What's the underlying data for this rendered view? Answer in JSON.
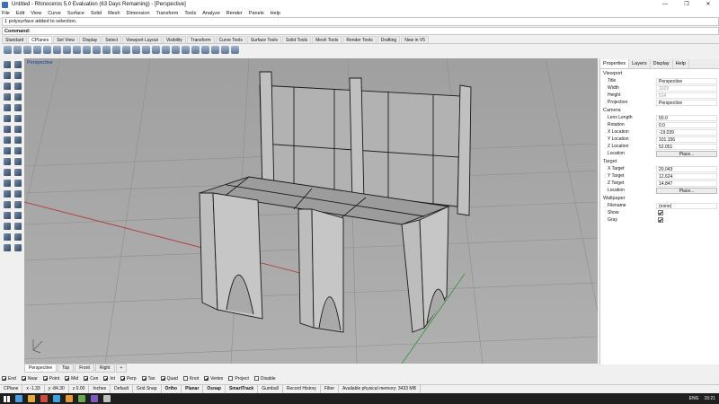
{
  "window": {
    "title": "Untitled - Rhinoceros 5.0 Evaluation (63 Days Remaining) - [Perspective]",
    "minimize": "—",
    "maximize": "❐",
    "close": "✕"
  },
  "menu": [
    "File",
    "Edit",
    "View",
    "Curve",
    "Surface",
    "Solid",
    "Mesh",
    "Dimension",
    "Transform",
    "Tools",
    "Analyze",
    "Render",
    "Panels",
    "Help"
  ],
  "history": "1 polysurface added to selection.",
  "command": {
    "label": "Command:",
    "value": ""
  },
  "tabs": [
    "Standard",
    "CPlanes",
    "Set View",
    "Display",
    "Select",
    "Viewport Layout",
    "Visibility",
    "Transform",
    "Curve Tools",
    "Surface Tools",
    "Solid Tools",
    "Mesh Tools",
    "Render Tools",
    "Drafting",
    "New in V5"
  ],
  "active_tab": "CPlanes",
  "viewport": {
    "label": "Perspective",
    "axis": "x y z"
  },
  "viewport_tabs": [
    "Perspective",
    "Top",
    "Front",
    "Right",
    "+"
  ],
  "osnap": [
    {
      "label": "End",
      "on": true
    },
    {
      "label": "Near",
      "on": true
    },
    {
      "label": "Point",
      "on": true
    },
    {
      "label": "Mid",
      "on": true
    },
    {
      "label": "Cen",
      "on": true
    },
    {
      "label": "Int",
      "on": true
    },
    {
      "label": "Perp",
      "on": true
    },
    {
      "label": "Tan",
      "on": true
    },
    {
      "label": "Quad",
      "on": true
    },
    {
      "label": "Knot",
      "on": false
    },
    {
      "label": "Vertex",
      "on": true
    },
    {
      "label": "Project",
      "on": false
    },
    {
      "label": "Disable",
      "on": false
    }
  ],
  "status": {
    "cplane": "CPlane",
    "x": "x -1.33",
    "y": "y -84.30",
    "z": "z 0.00",
    "units": "Inches",
    "layer": "Default",
    "grid_snap": "Grid Snap",
    "ortho": "Ortho",
    "planar": "Planar",
    "osnap": "Osnap",
    "smarttrack": "SmartTrack",
    "gumball": "Gumball",
    "record_history": "Record History",
    "filter": "Filter",
    "memory": "Available physical memory: 3433 MB"
  },
  "panel": {
    "tabs": [
      "Properties",
      "Layers",
      "Display",
      "Help"
    ],
    "viewport_section": "Viewport",
    "viewport_rows": [
      {
        "k": "Title",
        "v": "Perspective"
      },
      {
        "k": "Width",
        "v": "1029",
        "dim": true
      },
      {
        "k": "Height",
        "v": "514",
        "dim": true
      },
      {
        "k": "Projection",
        "v": "Perspective"
      }
    ],
    "camera_section": "Camera",
    "camera_rows": [
      {
        "k": "Lens Length",
        "v": "50.0"
      },
      {
        "k": "Rotation",
        "v": "0.0"
      },
      {
        "k": "X Location",
        "v": "-19.039"
      },
      {
        "k": "Y Location",
        "v": "101.156"
      },
      {
        "k": "Z Location",
        "v": "52.051"
      },
      {
        "k": "Location",
        "v": "Place...",
        "btn": true
      }
    ],
    "target_section": "Target",
    "target_rows": [
      {
        "k": "X Target",
        "v": "20.043"
      },
      {
        "k": "Y Target",
        "v": "12.624"
      },
      {
        "k": "Z Target",
        "v": "14.847"
      },
      {
        "k": "Location",
        "v": "Place...",
        "btn": true
      }
    ],
    "wallpaper_section": "Wallpaper",
    "wallpaper_rows": [
      {
        "k": "Filename",
        "v": "(none)"
      },
      {
        "k": "Show",
        "check": true
      },
      {
        "k": "Gray",
        "check": true
      }
    ]
  },
  "tray": {
    "lang": "ENG",
    "time": "15:21"
  }
}
